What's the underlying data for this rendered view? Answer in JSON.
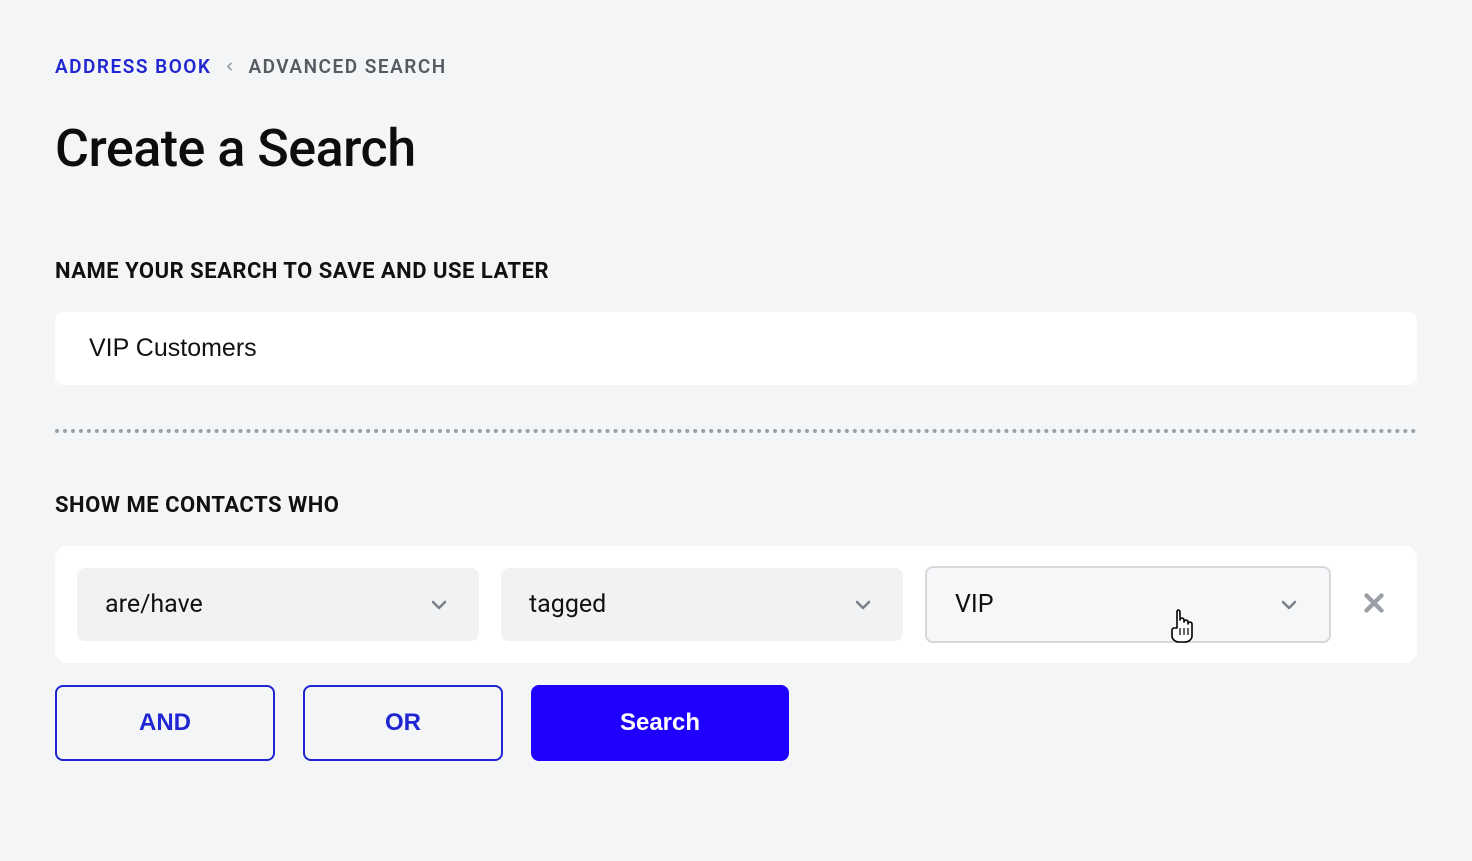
{
  "breadcrumb": {
    "root": "ADDRESS BOOK",
    "current": "ADVANCED SEARCH"
  },
  "page_title": "Create a Search",
  "name_section": {
    "label": "NAME YOUR SEARCH TO SAVE AND USE LATER",
    "value": "VIP Customers"
  },
  "filter_section": {
    "label": "SHOW ME CONTACTS WHO",
    "row": {
      "condition": "are/have",
      "attribute": "tagged",
      "value": "VIP"
    }
  },
  "actions": {
    "and": "AND",
    "or": "OR",
    "search": "Search"
  }
}
